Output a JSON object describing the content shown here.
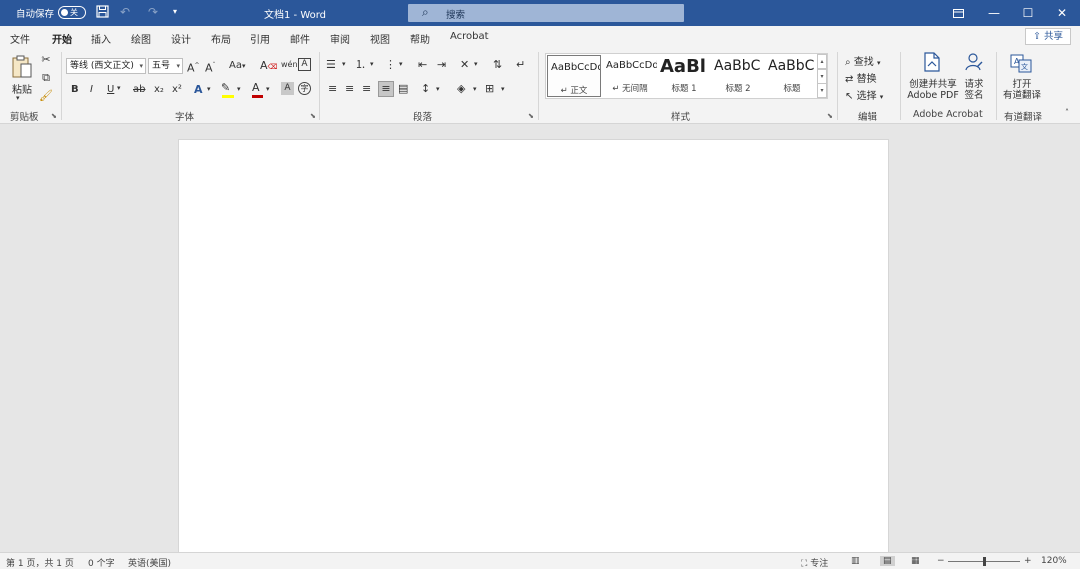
{
  "titlebar": {
    "autosave_label": "自动保存",
    "autosave_state": "关",
    "doc_title": "文档1 - Word",
    "search_placeholder": "搜索",
    "colors": {
      "bar": "#2b579a"
    }
  },
  "tabs": [
    {
      "label": "文件"
    },
    {
      "label": "开始",
      "active": true
    },
    {
      "label": "插入"
    },
    {
      "label": "绘图"
    },
    {
      "label": "设计"
    },
    {
      "label": "布局"
    },
    {
      "label": "引用"
    },
    {
      "label": "邮件"
    },
    {
      "label": "审阅"
    },
    {
      "label": "视图"
    },
    {
      "label": "帮助"
    },
    {
      "label": "Acrobat"
    }
  ],
  "share_label": "共享",
  "clipboard": {
    "paste_label": "粘贴",
    "group_label": "剪贴板"
  },
  "font": {
    "font_name": "等线 (西文正文)",
    "font_size": "五号",
    "change_case": "Aa",
    "group_label": "字体",
    "bold": "B",
    "italic": "I",
    "underline": "U",
    "strike": "ab",
    "subscript": "x₂",
    "superscript": "x²"
  },
  "paragraph": {
    "group_label": "段落"
  },
  "styles": {
    "group_label": "样式",
    "items": [
      {
        "preview": "AaBbCcDd",
        "name": "↵ 正文",
        "selected": true
      },
      {
        "preview": "AaBbCcDd",
        "name": "↵ 无间隔"
      },
      {
        "preview": "AaBl",
        "name": "标题 1"
      },
      {
        "preview": "AaBbC",
        "name": "标题 2"
      },
      {
        "preview": "AaBbC",
        "name": "标题"
      }
    ]
  },
  "editing": {
    "group_label": "编辑",
    "find": "查找",
    "replace": "替换",
    "select": "选择"
  },
  "acrobat": {
    "group_label": "Adobe Acrobat",
    "create_line1": "创建并共享",
    "create_line2": "Adobe PDF",
    "request_line1": "请求",
    "request_line2": "签名"
  },
  "translate": {
    "group_label": "有道翻译",
    "open_line1": "打开",
    "open_line2": "有道翻译"
  },
  "status": {
    "page": "第 1 页，共 1 页",
    "words": "0 个字",
    "language": "英语(美国)",
    "focus": "专注",
    "zoom": "120%"
  }
}
